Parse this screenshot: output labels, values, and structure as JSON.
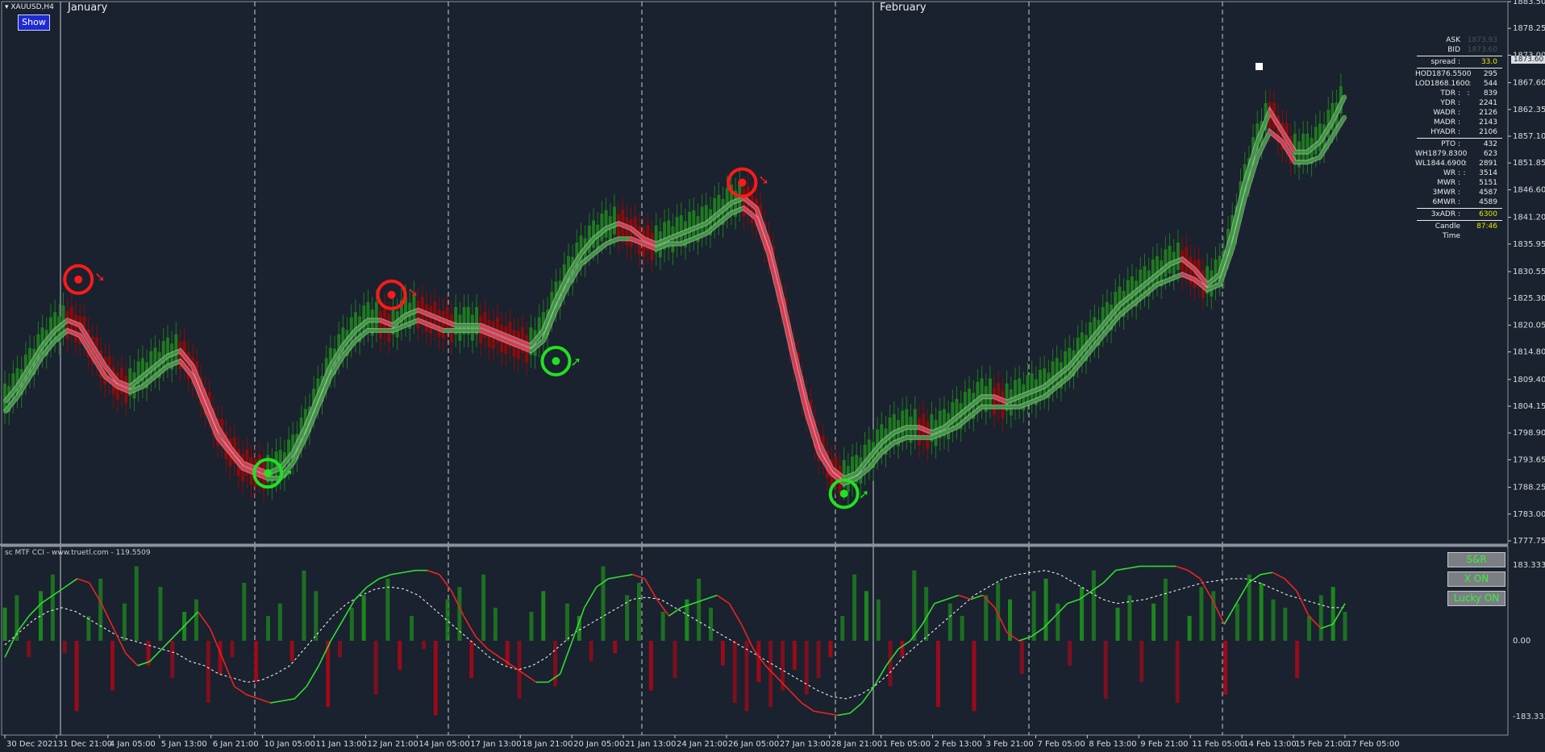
{
  "header": {
    "symbol": "XAUUSD,H4",
    "show_label": "Show"
  },
  "months": [
    "January",
    "February"
  ],
  "info_panel": {
    "ask_label": "ASK",
    "ask_value": "1873.93",
    "bid_label": "BID",
    "bid_value": "1873.60",
    "rows": [
      {
        "k": "spread :",
        "v": "33.0",
        "color": "#e6e600"
      },
      {
        "sep": true
      },
      {
        "k": "HOD1876.5500 :",
        "v": "295"
      },
      {
        "k": "LOD1868.1600 :",
        "v": "544"
      },
      {
        "k": "TDR :",
        "v": "839"
      },
      {
        "k": "YDR :",
        "v": "2241"
      },
      {
        "k": "WADR :",
        "v": "2126"
      },
      {
        "k": "MADR :",
        "v": "2143"
      },
      {
        "k": "HYADR :",
        "v": "2106"
      },
      {
        "sep": true
      },
      {
        "k": "PTO :",
        "v": "432"
      },
      {
        "k": "WH1879.8300 :",
        "v": "623"
      },
      {
        "k": "WL1844.6900 :",
        "v": "2891"
      },
      {
        "k": "WR :",
        "v": "3514"
      },
      {
        "k": "MWR :",
        "v": "5151"
      },
      {
        "k": "3MWR :",
        "v": "4587"
      },
      {
        "k": "6MWR :",
        "v": "4589"
      },
      {
        "sep": true
      },
      {
        "k": "3xADR :",
        "v": "6300",
        "color": "#e6e600"
      },
      {
        "sep": true
      },
      {
        "k": "Candle Time",
        "v": "87:46",
        "color": "#e6e600"
      }
    ]
  },
  "current_price_tag": "1873.60",
  "indicator": {
    "title": "sc MTF CCI - www.truetl.com - 119.5509",
    "buttons": [
      "S&R",
      "X ON",
      "Lucky ON"
    ],
    "levels": [
      "183.3333",
      "0.00",
      "-183.3333"
    ]
  },
  "colors": {
    "background": "#19222e",
    "bull": "#1f7a1f",
    "bear": "#8b0a0a",
    "band_red": "#e0384f",
    "band_green": "#3a9a3a",
    "signal_red": "#ff1a1a",
    "signal_green": "#22e022",
    "cci_fast_green": "#33dd33",
    "cci_fast_red": "#ee2222"
  },
  "chart_data": {
    "type": "line",
    "symbol": "XAUUSD",
    "timeframe": "H4",
    "y_axis": {
      "range": [
        1777.75,
        1883.5
      ],
      "ticks": [
        "1883.50",
        "1878.25",
        "1873.00",
        "1867.60",
        "1862.35",
        "1857.10",
        "1851.85",
        "1846.60",
        "1841.20",
        "1835.95",
        "1830.55",
        "1825.30",
        "1820.05",
        "1814.80",
        "1809.40",
        "1804.15",
        "1798.90",
        "1793.65",
        "1788.25",
        "1783.00",
        "1777.75"
      ]
    },
    "x_ticks": [
      "30 Dec 2021",
      "31 Dec 21:00",
      "4 Jan 05:00",
      "5 Jan 13:00",
      "6 Jan 21:00",
      "10 Jan 05:00",
      "11 Jan 13:00",
      "12 Jan 21:00",
      "14 Jan 05:00",
      "17 Jan 13:00",
      "18 Jan 21:00",
      "20 Jan 05:00",
      "21 Jan 13:00",
      "24 Jan 21:00",
      "26 Jan 05:00",
      "27 Jan 13:00",
      "28 Jan 21:00",
      "1 Feb 05:00",
      "2 Feb 13:00",
      "3 Feb 21:00",
      "7 Feb 05:00",
      "8 Feb 13:00",
      "9 Feb 21:00",
      "11 Feb 05:00",
      "14 Feb 13:00",
      "15 Feb 21:00",
      "17 Feb 05:00"
    ],
    "series": [
      {
        "values": [
          1805,
          1808,
          1812,
          1816,
          1819,
          1821,
          1820,
          1816,
          1812,
          1809,
          1808,
          1810,
          1812,
          1814,
          1815,
          1812,
          1806,
          1800,
          1796,
          1793,
          1792,
          1791,
          1792,
          1795,
          1800,
          1806,
          1812,
          1816,
          1819,
          1821,
          1821,
          1820,
          1822,
          1823,
          1822,
          1821,
          1820,
          1820,
          1820,
          1819,
          1818,
          1817,
          1816,
          1819,
          1825,
          1830,
          1834,
          1837,
          1839,
          1840,
          1839,
          1837,
          1836,
          1837,
          1838,
          1839,
          1840,
          1842,
          1844,
          1845,
          1843,
          1836,
          1826,
          1815,
          1805,
          1797,
          1792,
          1790,
          1791,
          1794,
          1797,
          1799,
          1800,
          1800,
          1799,
          1800,
          1802,
          1804,
          1806,
          1806,
          1805,
          1806,
          1807,
          1808,
          1810,
          1812,
          1815,
          1818,
          1821,
          1824,
          1826,
          1828,
          1830,
          1832,
          1833,
          1831,
          1828,
          1830,
          1838,
          1848,
          1856,
          1862,
          1858,
          1854,
          1854,
          1856,
          1860,
          1865
        ]
      },
      {
        "values": [
          1803,
          1806,
          1810,
          1814,
          1817,
          1819,
          1818,
          1814,
          1810,
          1808,
          1807,
          1808,
          1810,
          1812,
          1813,
          1810,
          1804,
          1798,
          1795,
          1792,
          1791,
          1790,
          1790,
          1793,
          1798,
          1804,
          1810,
          1814,
          1817,
          1819,
          1819,
          1819,
          1820,
          1821,
          1820,
          1819,
          1819,
          1819,
          1819,
          1818,
          1817,
          1816,
          1815,
          1817,
          1823,
          1828,
          1832,
          1834,
          1836,
          1837,
          1837,
          1836,
          1835,
          1836,
          1836,
          1837,
          1838,
          1840,
          1842,
          1843,
          1841,
          1834,
          1824,
          1813,
          1803,
          1795,
          1791,
          1789,
          1790,
          1792,
          1795,
          1797,
          1798,
          1798,
          1798,
          1799,
          1800,
          1802,
          1804,
          1804,
          1804,
          1804,
          1805,
          1806,
          1808,
          1810,
          1813,
          1816,
          1819,
          1822,
          1824,
          1826,
          1828,
          1829,
          1830,
          1829,
          1827,
          1828,
          1835,
          1845,
          1853,
          1858,
          1856,
          1852,
          1852,
          1853,
          1857,
          1861
        ]
      }
    ],
    "markers": {
      "sell_circles": [
        1829,
        1826,
        1848
      ],
      "buy_circles": [
        1791,
        1813,
        1787
      ]
    },
    "cci_levels": [
      183.3333,
      0,
      -183.3333
    ],
    "cci_fast": [
      -40,
      20,
      60,
      90,
      110,
      130,
      150,
      140,
      90,
      30,
      -30,
      -60,
      -50,
      -20,
      10,
      40,
      70,
      30,
      -40,
      -110,
      -130,
      -140,
      -150,
      -145,
      -140,
      -110,
      -60,
      0,
      50,
      100,
      130,
      150,
      160,
      165,
      170,
      170,
      160,
      120,
      60,
      10,
      -20,
      -40,
      -60,
      -80,
      -100,
      -100,
      -80,
      0,
      80,
      130,
      150,
      155,
      160,
      150,
      100,
      60,
      80,
      90,
      100,
      110,
      90,
      40,
      -20,
      -60,
      -90,
      -120,
      -150,
      -170,
      -175,
      -180,
      -175,
      -150,
      -110,
      -60,
      -20,
      0,
      40,
      90,
      100,
      110,
      100,
      110,
      80,
      20,
      0,
      10,
      30,
      60,
      90,
      100,
      120,
      140,
      170,
      175,
      180,
      180,
      180,
      180,
      170,
      150,
      100,
      40,
      90,
      140,
      160,
      165,
      150,
      120,
      60,
      30,
      40,
      90
    ],
    "cci_slow": [
      -10,
      20,
      50,
      70,
      80,
      70,
      50,
      30,
      10,
      0,
      -10,
      -20,
      -30,
      -50,
      -60,
      -80,
      -90,
      -100,
      -95,
      -80,
      -60,
      -20,
      20,
      60,
      90,
      110,
      125,
      130,
      125,
      110,
      80,
      50,
      20,
      -10,
      -40,
      -60,
      -70,
      -60,
      -40,
      -10,
      20,
      40,
      60,
      80,
      100,
      105,
      100,
      80,
      60,
      40,
      20,
      0,
      -20,
      -40,
      -60,
      -80,
      -100,
      -120,
      -135,
      -140,
      -130,
      -110,
      -80,
      -40,
      -10,
      20,
      50,
      80,
      110,
      130,
      150,
      160,
      165,
      170,
      160,
      140,
      120,
      100,
      90,
      95,
      100,
      110,
      120,
      130,
      140,
      145,
      150,
      150,
      140,
      125,
      110,
      100,
      90,
      80,
      80
    ],
    "cci_histogram": [
      80,
      110,
      -40,
      120,
      160,
      -30,
      -170,
      60,
      150,
      -120,
      90,
      180,
      -60,
      130,
      -90,
      70,
      100,
      -150,
      -80,
      -40,
      140,
      -100,
      60,
      90,
      -50,
      170,
      120,
      -160,
      -40,
      80,
      110,
      -130,
      150,
      -70,
      60,
      -20,
      -180,
      100,
      130,
      -90,
      160,
      80,
      -60,
      -140,
      70,
      120,
      -110,
      90,
      60,
      -50,
      180,
      -30,
      110,
      140,
      -120,
      70,
      -90,
      100,
      150,
      80,
      -60,
      -150,
      -170,
      -100,
      -160,
      -120,
      -70,
      -130,
      -90,
      -40,
      60,
      160,
      120,
      100,
      -110,
      -40,
      170,
      130,
      -160,
      90,
      60,
      -170,
      110,
      140,
      100,
      -80,
      120,
      150,
      90,
      -60,
      130,
      170,
      -140,
      80,
      110,
      -100,
      90,
      150,
      -150,
      60,
      130,
      120,
      -130,
      90,
      160,
      140,
      100,
      80,
      -90,
      60,
      110,
      130,
      70
    ]
  }
}
